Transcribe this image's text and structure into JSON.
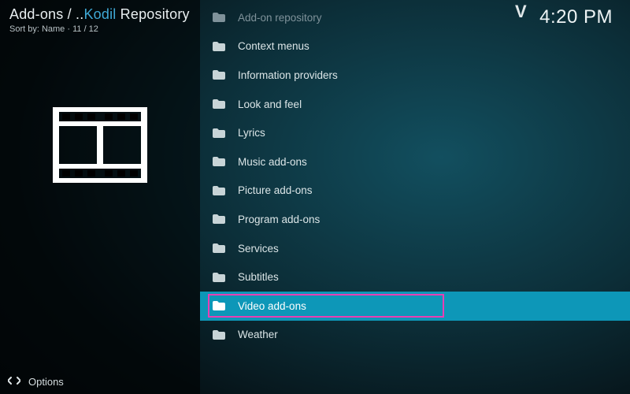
{
  "header": {
    "breadcrumb_prefix": "Add-ons / ..",
    "breadcrumb_highlight": "Kodil",
    "breadcrumb_suffix": " Repository",
    "sort_label": "Sort by: Name",
    "sort_sep": " · ",
    "position": "11 / 12"
  },
  "clock": "4:20 PM",
  "marker": "V",
  "items": [
    {
      "label": "Add-on repository",
      "dim": true
    },
    {
      "label": "Context menus"
    },
    {
      "label": "Information providers"
    },
    {
      "label": "Look and feel"
    },
    {
      "label": "Lyrics"
    },
    {
      "label": "Music add-ons"
    },
    {
      "label": "Picture add-ons"
    },
    {
      "label": "Program add-ons"
    },
    {
      "label": "Services"
    },
    {
      "label": "Subtitles"
    },
    {
      "label": "Video add-ons",
      "selected": true
    },
    {
      "label": "Weather"
    }
  ],
  "footer": {
    "options": "Options"
  }
}
